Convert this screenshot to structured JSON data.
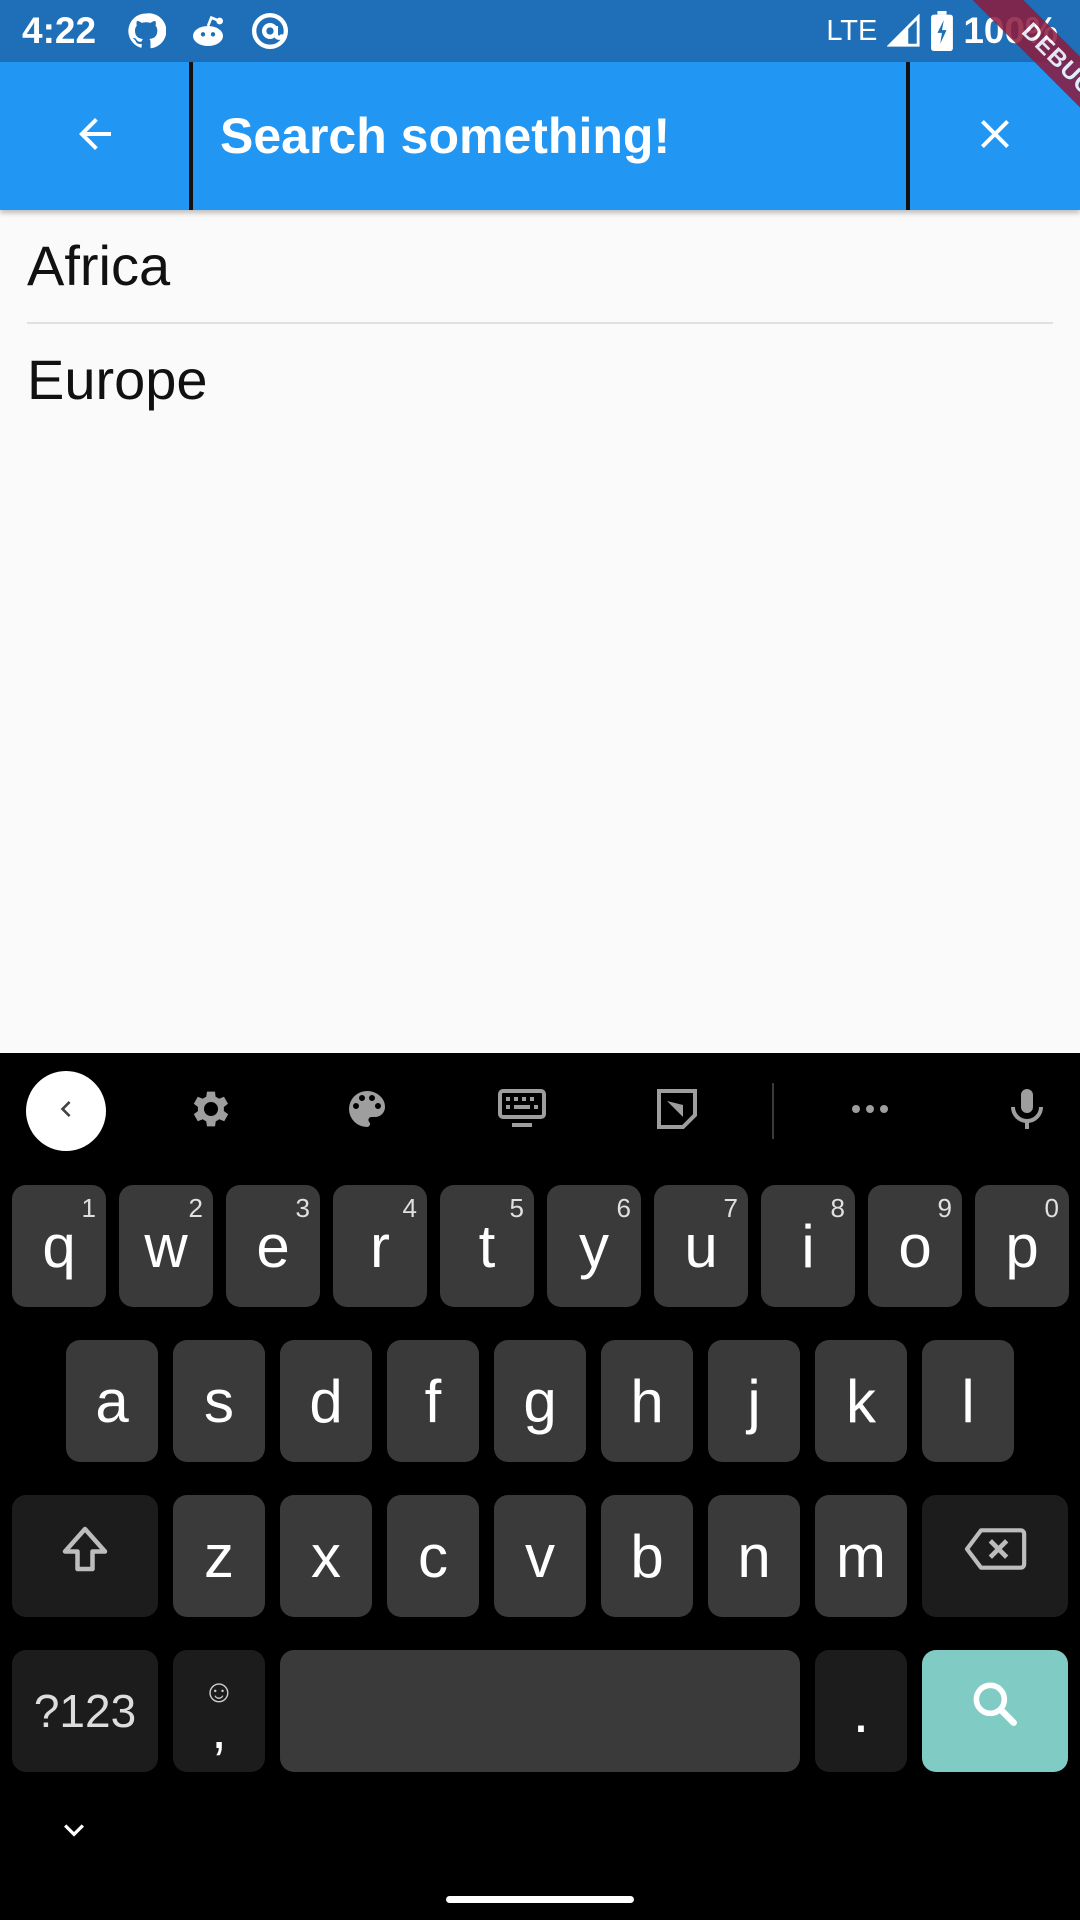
{
  "status_bar": {
    "time": "4:22",
    "network": "LTE",
    "battery": "100%",
    "left_icons": [
      "github-icon",
      "reddit-icon",
      "at-sign-icon"
    ]
  },
  "app_bar": {
    "color": "#2196f3",
    "search_placeholder": "Search something!",
    "search_value": ""
  },
  "debug_banner": "DEBUG",
  "results": [
    {
      "label": "Africa"
    },
    {
      "label": "Europe"
    }
  ],
  "keyboard": {
    "toolbar_icons": [
      "chevron-left-icon",
      "gear-icon",
      "palette-icon",
      "keyboard-icon",
      "sticker-icon",
      "more-dots-icon",
      "microphone-icon"
    ],
    "row1": [
      {
        "label": "q",
        "hint": "1"
      },
      {
        "label": "w",
        "hint": "2"
      },
      {
        "label": "e",
        "hint": "3"
      },
      {
        "label": "r",
        "hint": "4"
      },
      {
        "label": "t",
        "hint": "5"
      },
      {
        "label": "y",
        "hint": "6"
      },
      {
        "label": "u",
        "hint": "7"
      },
      {
        "label": "i",
        "hint": "8"
      },
      {
        "label": "o",
        "hint": "9"
      },
      {
        "label": "p",
        "hint": "0"
      }
    ],
    "row2": [
      "a",
      "s",
      "d",
      "f",
      "g",
      "h",
      "j",
      "k",
      "l"
    ],
    "row3": [
      "z",
      "x",
      "c",
      "v",
      "b",
      "n",
      "m"
    ],
    "mode_key": "?123",
    "comma_key": ",",
    "emoji_glyph": "☺",
    "period_key": ".",
    "action_color": "#80cbc4"
  }
}
